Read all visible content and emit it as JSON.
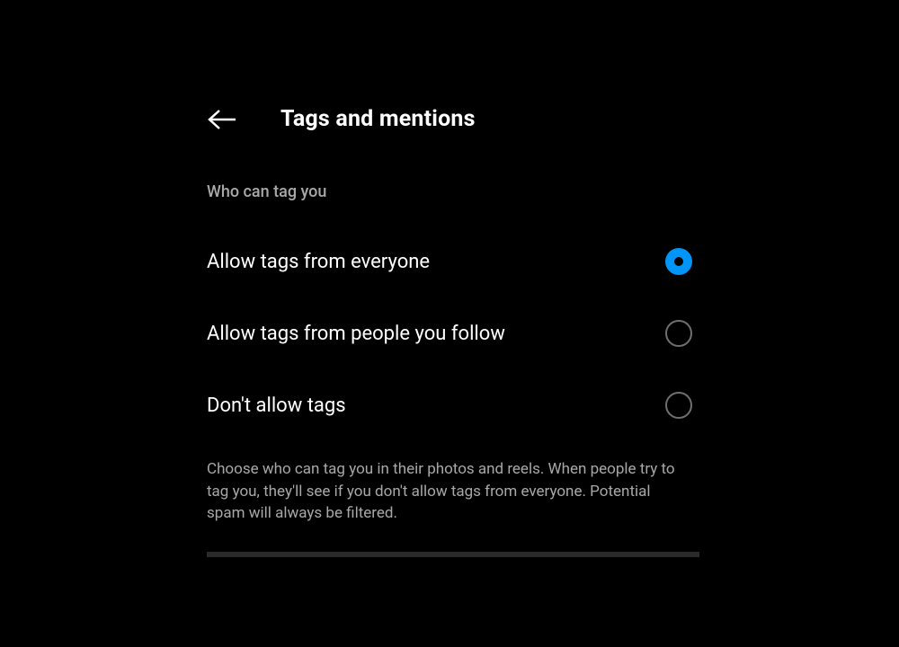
{
  "header": {
    "title": "Tags and mentions"
  },
  "section": {
    "label": "Who can tag you",
    "options": [
      {
        "label": "Allow tags from everyone",
        "selected": true
      },
      {
        "label": "Allow tags from people you follow",
        "selected": false
      },
      {
        "label": "Don't allow tags",
        "selected": false
      }
    ],
    "description": "Choose who can tag you in their photos and reels. When people try to tag you, they'll see if you don't allow tags from everyone. Potential spam will always be filtered."
  }
}
